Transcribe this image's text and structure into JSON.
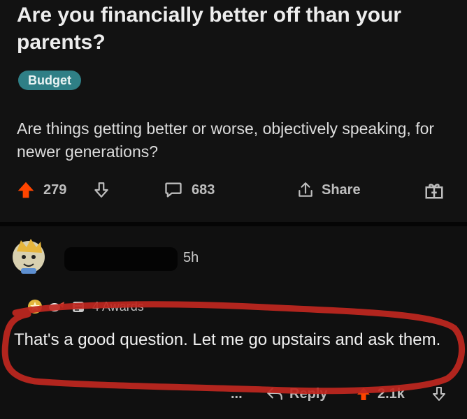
{
  "post": {
    "title": "Are you financially better off than your parents?",
    "flair": "Budget",
    "body": "Are things getting better or worse, objectively speaking, for newer generations?",
    "upvotes": "279",
    "comments": "683",
    "share_label": "Share"
  },
  "comment": {
    "time": "5h",
    "awards": "4 Awards",
    "text": "That's a good question. Let me go upstairs and ask them.",
    "more": "...",
    "reply_label": "Reply",
    "votes": "2.1k"
  },
  "colors": {
    "upvote": "#ff4500",
    "flair_bg": "#2f7f86",
    "annotation": "#c0271f"
  }
}
